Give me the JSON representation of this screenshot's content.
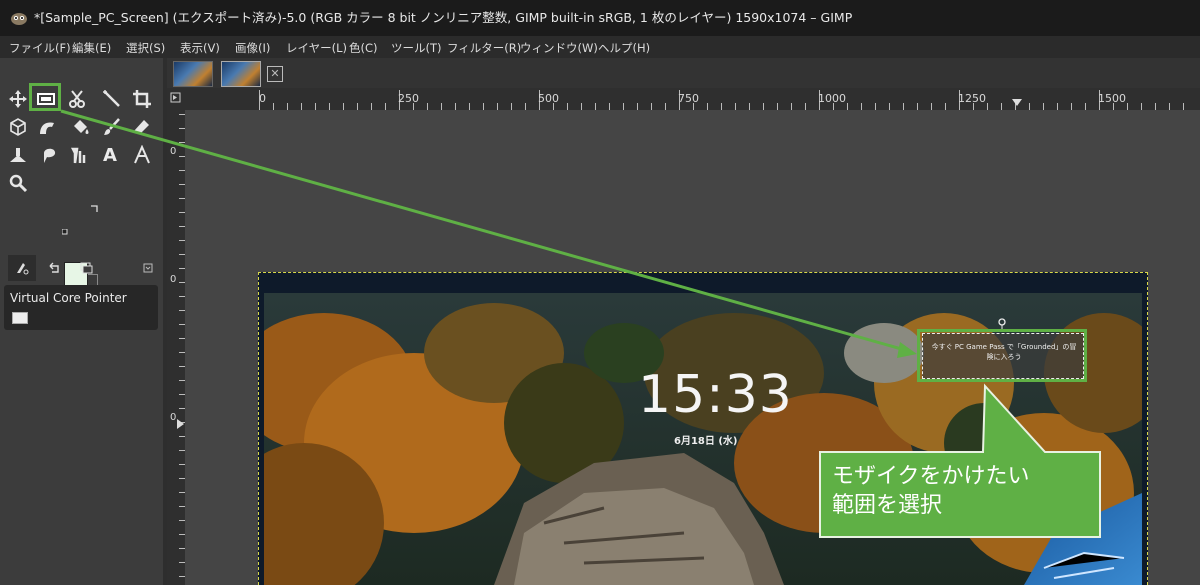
{
  "window": {
    "title": "*[Sample_PC_Screen] (エクスポート済み)-5.0 (RGB カラー 8 bit ノンリニア整数, GIMP built-in sRGB, 1 枚のレイヤー) 1590x1074 – GIMP"
  },
  "menu": {
    "items": [
      "ファイル(F)",
      "編集(E)",
      "選択(S)",
      "表示(V)",
      "画像(I)",
      "レイヤー(L)",
      "色(C)",
      "ツール(T)",
      "フィルター(R)",
      "ウィンドウ(W)",
      "ヘルプ(H)"
    ]
  },
  "toolbox": {
    "tools": [
      "move-tool",
      "rect-select-tool",
      "cut-tool",
      "fuzzy-select-tool",
      "crop-tool",
      "3d-transform-tool",
      "warp-tool",
      "bucket-fill-tool",
      "paintbrush-tool",
      "eraser-tool",
      "clone-tool",
      "smudge-tool",
      "paths-tool",
      "text-tool",
      "measure-tool",
      "zoom-tool"
    ],
    "text_tool_glyph": "A",
    "fg_color": "#e7f6e6",
    "bg_color": "#3a3a3a",
    "highlight_color": "#5fb045"
  },
  "device_panel": {
    "label": "Virtual Core Pointer"
  },
  "ruler": {
    "h_labels": [
      "0",
      "250",
      "500",
      "750",
      "1000",
      "1250",
      "1500"
    ],
    "v_labels": [
      "0",
      "0",
      "0"
    ]
  },
  "lockscreen": {
    "time": "15:33",
    "date": "6月18日 (水)",
    "notification": "今すぐ PC Game Pass で「Grounded」の冒険に入ろう"
  },
  "callout": {
    "line1": "モザイクをかけたい",
    "line2": "範囲を選択",
    "color": "#5fb045"
  }
}
